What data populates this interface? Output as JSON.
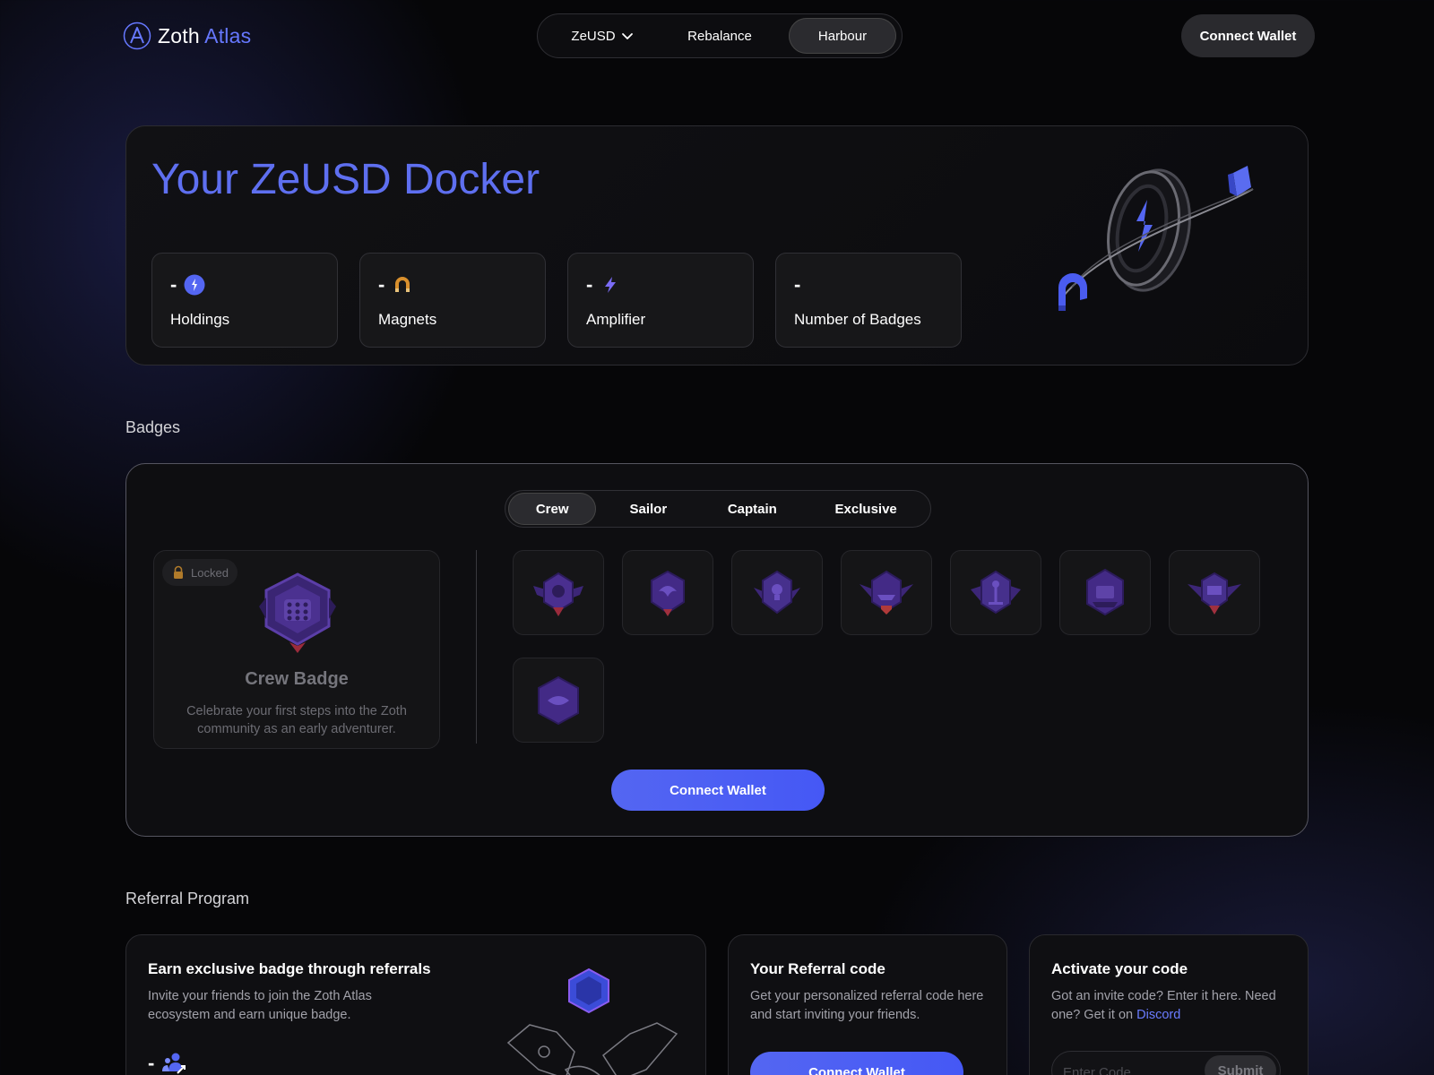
{
  "header": {
    "logo_word1": "Zoth",
    "logo_word2": "Atlas",
    "nav": {
      "zeusd": "ZeUSD",
      "rebalance": "Rebalance",
      "harbour": "Harbour"
    },
    "connect_wallet": "Connect Wallet"
  },
  "docker": {
    "title": "Your ZeUSD Docker",
    "stats": [
      {
        "value": "-",
        "label": "Holdings",
        "icon": "zeusd-coin-icon"
      },
      {
        "value": "-",
        "label": "Magnets",
        "icon": "magnet-icon"
      },
      {
        "value": "-",
        "label": "Amplifier",
        "icon": "lightning-icon"
      },
      {
        "value": "-",
        "label": "Number of Badges"
      }
    ]
  },
  "badges": {
    "section_title": "Badges",
    "tabs": [
      "Crew",
      "Sailor",
      "Captain",
      "Exclusive"
    ],
    "active_tab": "Crew",
    "featured": {
      "status": "Locked",
      "name": "Crew Badge",
      "description": "Celebrate your first steps into the Zoth community as an early adventurer."
    },
    "tile_count": 8,
    "connect_wallet": "Connect Wallet"
  },
  "referral": {
    "section_title": "Referral Program",
    "earn": {
      "title": "Earn exclusive badge through referrals",
      "description": "Invite your friends to join the Zoth Atlas ecosystem and earn unique badge.",
      "count": "-"
    },
    "code": {
      "title": "Your Referral code",
      "description": "Get your personalized referral code here and start inviting your friends.",
      "button": "Connect Wallet"
    },
    "activate": {
      "title": "Activate your code",
      "description": "Got an invite code? Enter it here. Need one? Get it on",
      "link": "Discord",
      "placeholder": "Enter Code",
      "submit": "Submit"
    }
  },
  "colors": {
    "accent": "#5e6ff0",
    "button": "#4f62f4",
    "background": "#060608",
    "card": "#171719"
  }
}
